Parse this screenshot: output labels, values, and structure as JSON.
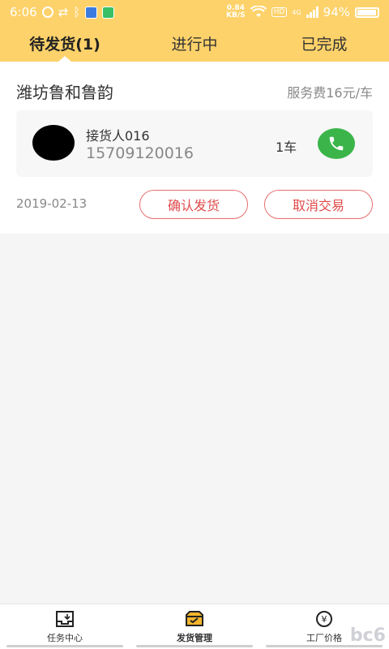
{
  "statusbar": {
    "time": "6:06",
    "net_speed": "0.84",
    "net_unit": "KB/S",
    "hd": "HD",
    "network": "4G",
    "battery": "94%"
  },
  "tabs": [
    {
      "label": "待发货(1)",
      "active": true
    },
    {
      "label": "进行中",
      "active": false
    },
    {
      "label": "已完成",
      "active": false
    }
  ],
  "order": {
    "company": "潍坊鲁和鲁韵",
    "fee": "服务费16元/车",
    "receiver_name": "接货人016",
    "receiver_phone": "15709120016",
    "quantity": "1车",
    "date": "2019-02-13",
    "confirm_label": "确认发货",
    "cancel_label": "取消交易"
  },
  "bottom_nav": [
    {
      "label": "任务中心",
      "icon": "inbox-icon",
      "active": false
    },
    {
      "label": "发货管理",
      "icon": "truck-box-icon",
      "active": true
    },
    {
      "label": "工厂价格",
      "icon": "yen-icon",
      "active": false
    }
  ],
  "watermark": "bc6",
  "colors": {
    "primary": "#fdd26a",
    "call_green": "#3bb54a",
    "button_red": "#e04b4b"
  }
}
